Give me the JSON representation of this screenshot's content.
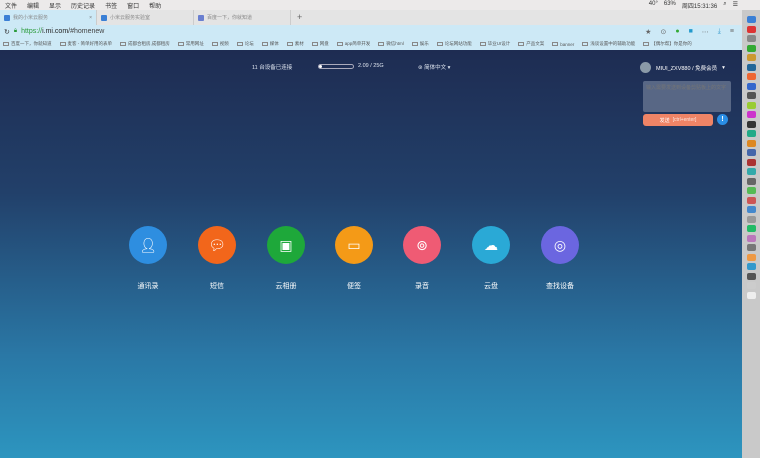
{
  "menubar": {
    "items": [
      "文件",
      "编辑",
      "显示",
      "历史记录",
      "书签",
      "窗口",
      "帮助"
    ],
    "status": {
      "temp": "40°",
      "battery": "63%",
      "clock": "周四15:31:36"
    }
  },
  "tabs": [
    {
      "title": "我的小米云服务",
      "active": true
    },
    {
      "title": "小米云服务实验室"
    },
    {
      "title": "百度一下，你就知道"
    }
  ],
  "address": {
    "scheme": "https://",
    "host": "i.mi.com",
    "path": "/#homenew"
  },
  "bookmarks": [
    "百度一下，你就知道",
    "麦客 - 简单好用的表单",
    "成都合租房,成都租房",
    "常用网址",
    "视频",
    "论坛",
    "媒体",
    "素材",
    "网盘",
    "app简单开发",
    "微信html",
    "娱乐",
    "论坛网站功能",
    "毕业UI设计",
    "产品文案",
    "banner",
    "浅谈设置中的辅助功能",
    "【偶尔帮】你是你的"
  ],
  "header": {
    "devices": "11 台设备已连接",
    "storage_used": "2.09 / 25G",
    "storage_fraction": 0.08,
    "language": "简体中文",
    "user": "MIUI_ZXV880 / 免费会员"
  },
  "clipboard": {
    "placeholder": "输入需要发送到设备剪贴板上的文字",
    "send_label": "发送",
    "send_hint": "[ctrl+enter]"
  },
  "apps": [
    {
      "label": "通讯录",
      "color": "#2e8ee0"
    },
    {
      "label": "短信",
      "color": "#f2661b"
    },
    {
      "label": "云相册",
      "color": "#1ea83a"
    },
    {
      "label": "便签",
      "color": "#f49a17"
    },
    {
      "label": "录音",
      "color": "#ef5b74"
    },
    {
      "label": "云盘",
      "color": "#2aa9d6"
    },
    {
      "label": "查找设备",
      "color": "#6b66e0"
    }
  ]
}
